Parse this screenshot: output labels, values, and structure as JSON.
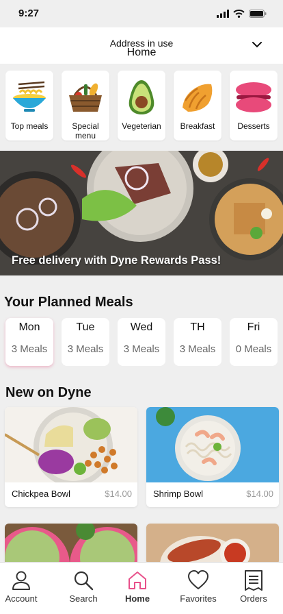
{
  "status": {
    "time": "9:27"
  },
  "header": {
    "address_label": "Address in use",
    "address_value": "Home"
  },
  "categories": [
    {
      "label": "Top meals",
      "icon": "noodle-bowl-icon"
    },
    {
      "label": "Special menu",
      "icon": "picnic-basket-icon"
    },
    {
      "label": "Vegeterian",
      "icon": "avocado-icon"
    },
    {
      "label": "Breakfast",
      "icon": "croissant-icon"
    },
    {
      "label": "Desserts",
      "icon": "macaron-icon"
    }
  ],
  "hero": {
    "text": "Free delivery with Dyne Rewards Pass!"
  },
  "planned": {
    "title": "Your Planned Meals",
    "days": [
      {
        "name": "Mon",
        "count": "3 Meals"
      },
      {
        "name": "Tue",
        "count": "3 Meals"
      },
      {
        "name": "Wed",
        "count": "3 Meals"
      },
      {
        "name": "TH",
        "count": "3 Meals"
      },
      {
        "name": "Fri",
        "count": "0 Meals"
      }
    ]
  },
  "new_on": {
    "title": "New on Dyne",
    "items": [
      {
        "name": "Chickpea Bowl",
        "price": "$14.00"
      },
      {
        "name": "Shrimp Bowl",
        "price": "$14.00"
      }
    ]
  },
  "tabs": [
    {
      "label": "Account",
      "icon": "person-icon"
    },
    {
      "label": "Search",
      "icon": "search-icon"
    },
    {
      "label": "Home",
      "icon": "home-icon"
    },
    {
      "label": "Favorites",
      "icon": "heart-icon"
    },
    {
      "label": "Orders",
      "icon": "receipt-icon"
    }
  ],
  "colors": {
    "accent": "#e8508a",
    "background": "#efefef"
  }
}
